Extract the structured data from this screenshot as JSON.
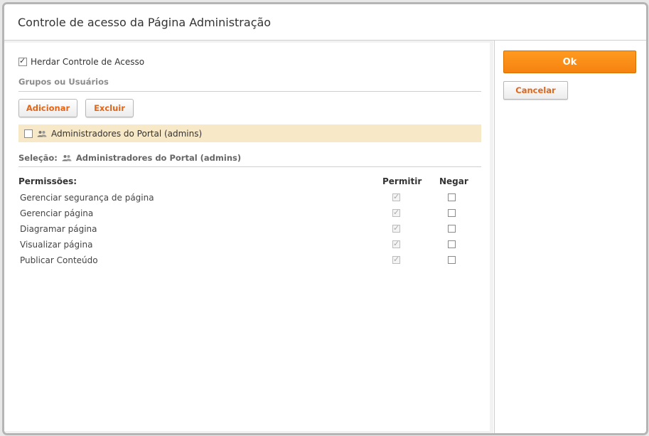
{
  "dialog": {
    "title": "Controle de acesso da Página Administração"
  },
  "inherit": {
    "label": "Herdar Controle de Acesso",
    "checked": true
  },
  "groups": {
    "section_title": "Grupos ou Usuários",
    "add_label": "Adicionar",
    "delete_label": "Excluir",
    "items": [
      {
        "name": "Administradores do Portal (admins)",
        "checked": false,
        "icon": "users-icon"
      }
    ]
  },
  "selection": {
    "label": "Seleção:",
    "value": "Administradores do Portal (admins)",
    "icon": "users-icon"
  },
  "permissions": {
    "header": "Permissões:",
    "allow_header": "Permitir",
    "deny_header": "Negar",
    "rows": [
      {
        "label": "Gerenciar segurança de página",
        "allow": true,
        "deny": false
      },
      {
        "label": "Gerenciar página",
        "allow": true,
        "deny": false
      },
      {
        "label": "Diagramar página",
        "allow": true,
        "deny": false
      },
      {
        "label": "Visualizar página",
        "allow": true,
        "deny": false
      },
      {
        "label": "Publicar Conteúdo",
        "allow": true,
        "deny": false
      }
    ]
  },
  "actions": {
    "ok_label": "Ok",
    "cancel_label": "Cancelar"
  },
  "colors": {
    "accent": "#f58210",
    "link_orange": "#e2661a",
    "selected_row": "#f7e8c7"
  }
}
